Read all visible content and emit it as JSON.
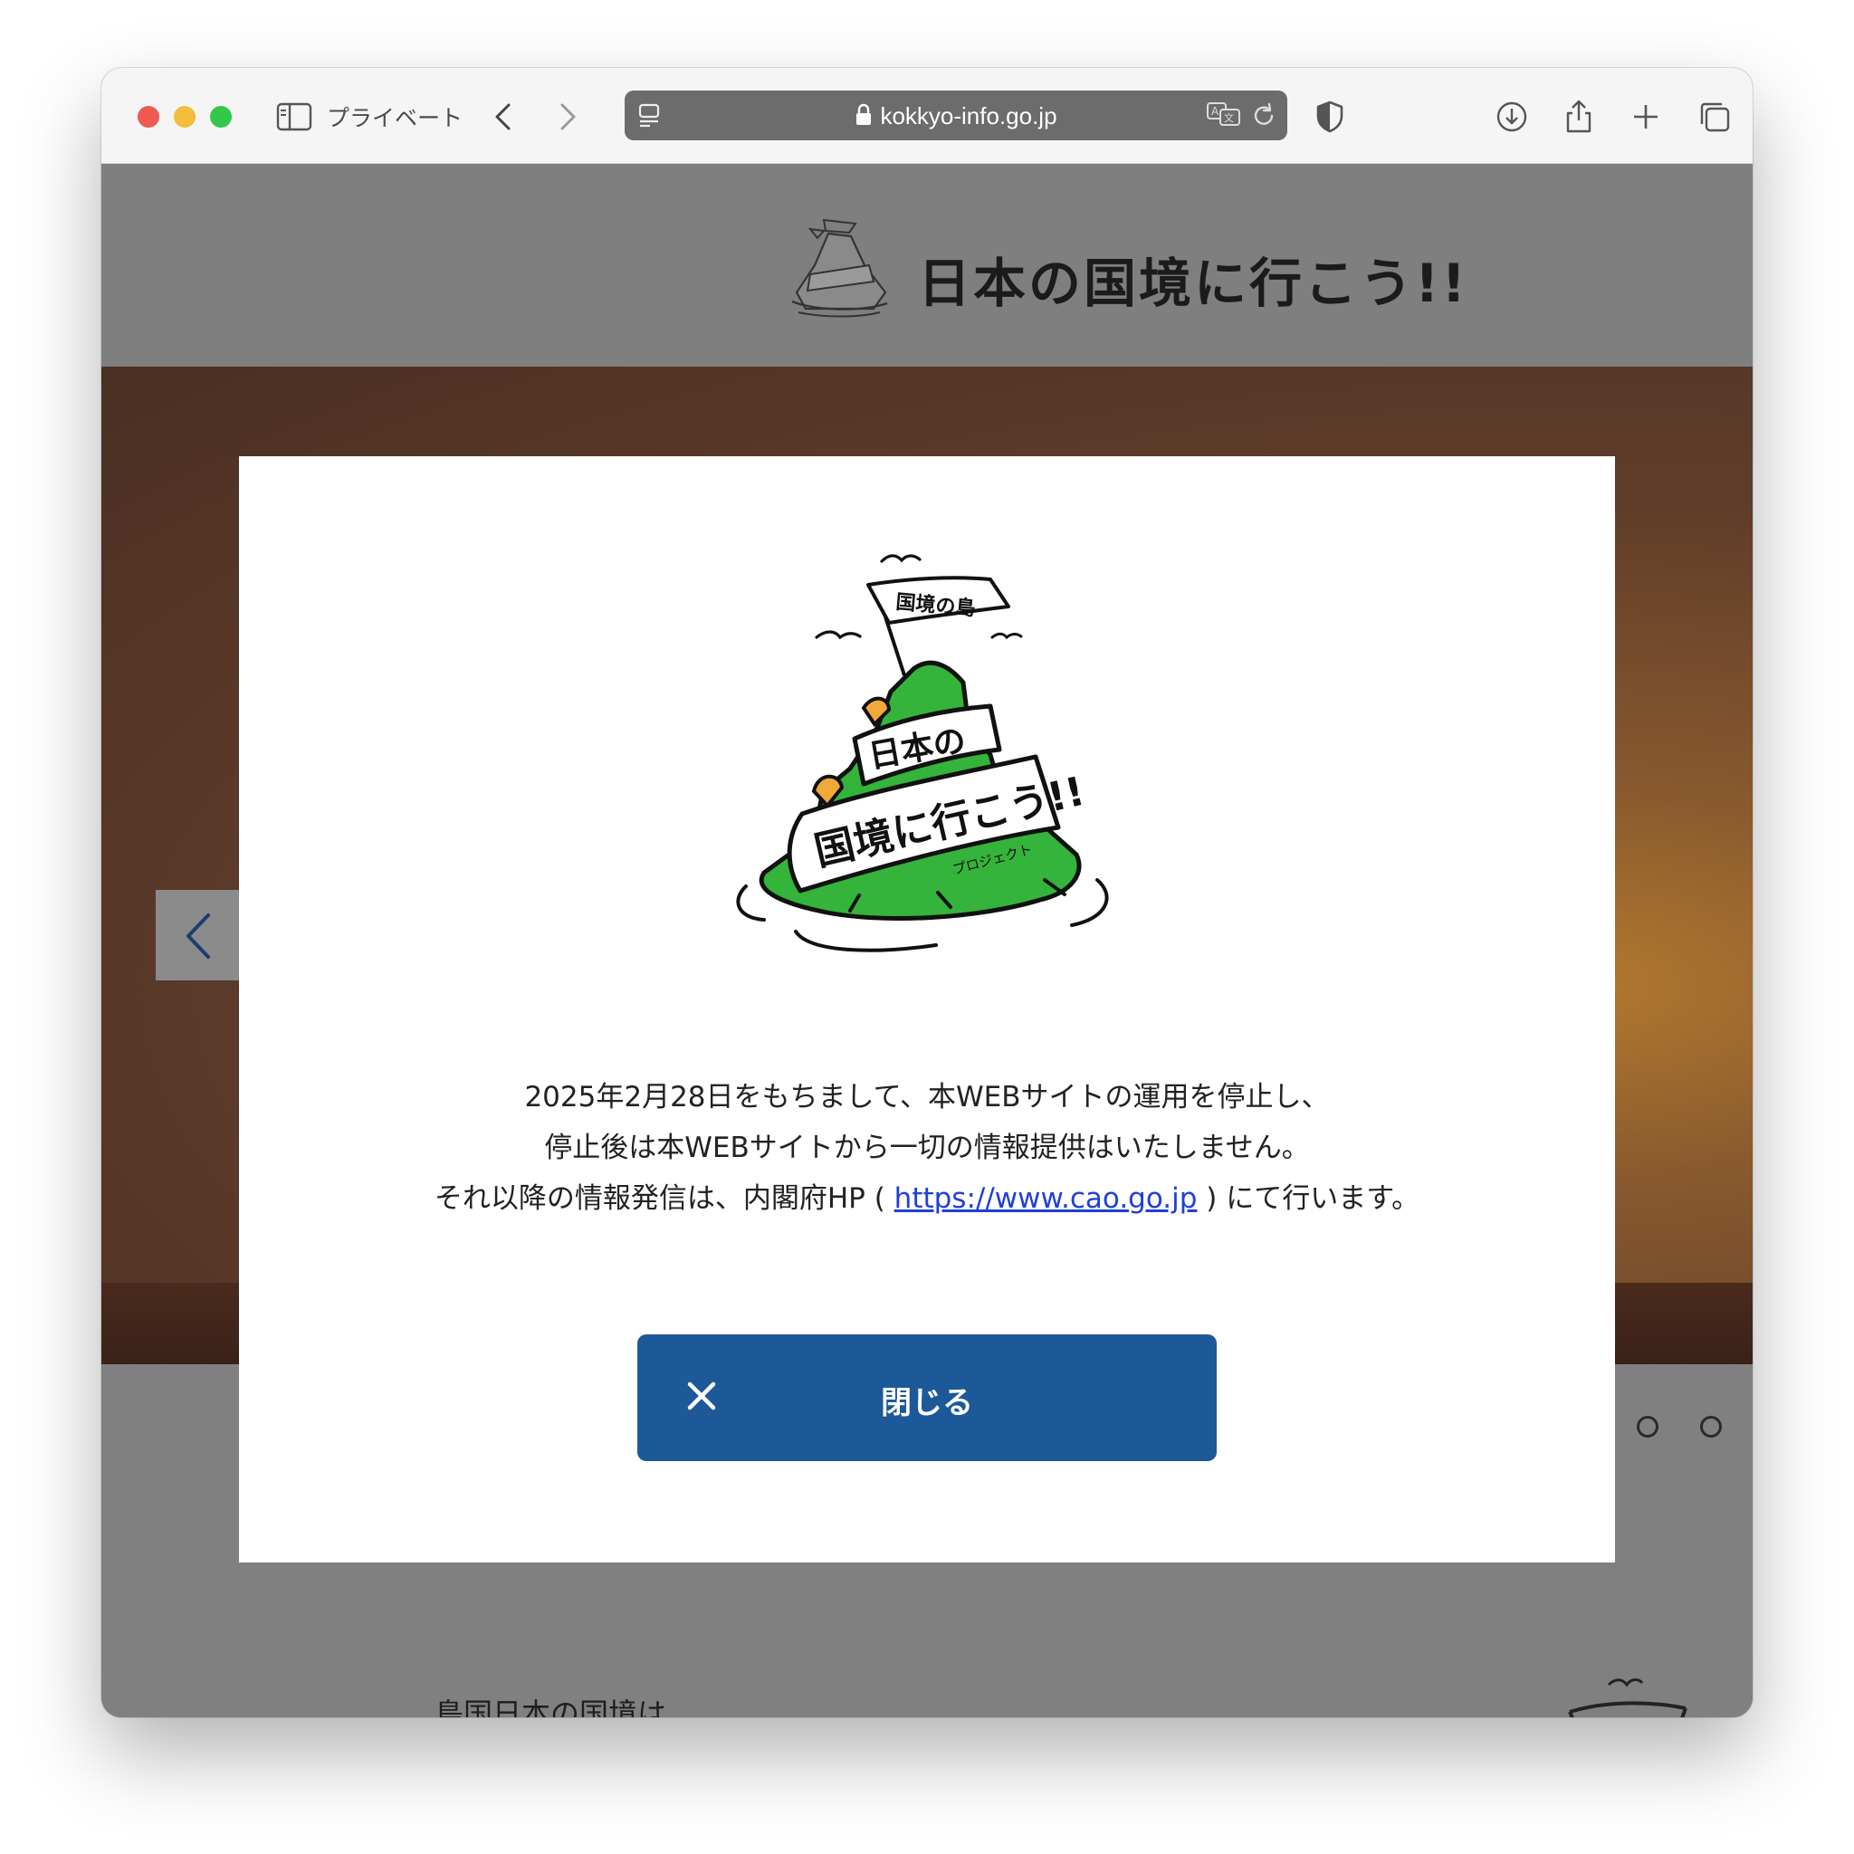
{
  "browser": {
    "private_label": "プライベート",
    "url": "kokkyo-info.go.jp",
    "traffic_lights": {
      "close": "#ee5a52",
      "minimize": "#f4bd3a",
      "zoom": "#34c84a"
    },
    "icons": [
      "sidebar-icon",
      "back-chevron-icon",
      "forward-chevron-icon",
      "page-menu-icon",
      "lock-icon",
      "translate-icon",
      "reload-icon",
      "privacy-shield-icon",
      "download-icon",
      "share-icon",
      "new-tab-icon",
      "tab-overview-icon"
    ]
  },
  "site": {
    "title": "日本の国境に行こう!!",
    "intro_heading": "島国日本の国境は"
  },
  "modal": {
    "logo_flag_text": "国境の島",
    "logo_banner_top": "日本の",
    "logo_banner_main": "国境に行こう!!",
    "logo_banner_sub": "プロジェクト",
    "message_line1": "2025年2月28日をもちまして、本WEBサイトの運用を停止し、",
    "message_line2": "停止後は本WEBサイトから一切の情報提供はいたしません。",
    "message_line3_prefix": "それ以降の情報発信は、内閣府HP ( ",
    "message_link": "https://www.cao.go.jp",
    "message_line3_suffix": " ) にて行います。",
    "close_label": "閉じる",
    "close_button_color": "#1d5899"
  },
  "colors": {
    "overlay": "#808080",
    "link": "#1f3fd8",
    "logo_green": "#34b43a",
    "logo_orange": "#f2a93b"
  }
}
